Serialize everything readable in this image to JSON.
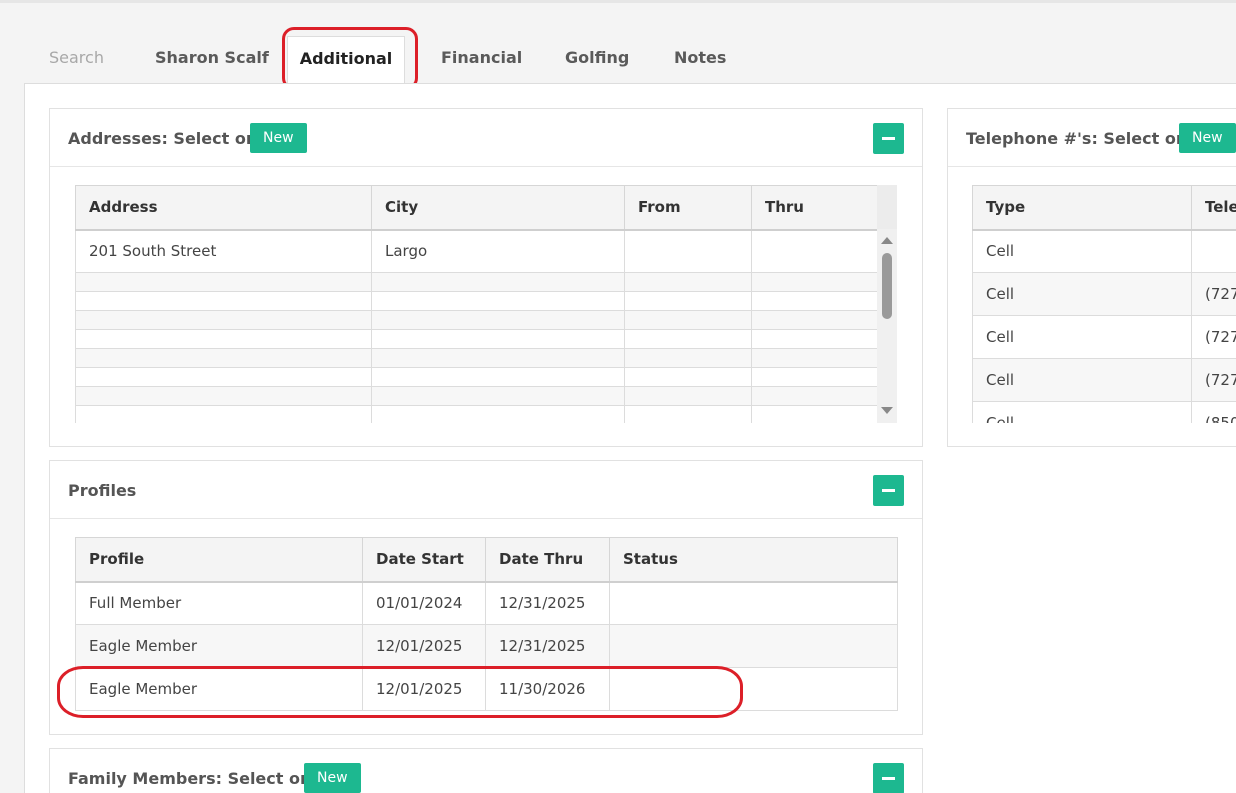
{
  "tabs": [
    "Search",
    "Sharon Scalf",
    "Additional",
    "Financial",
    "Golfing",
    "Notes"
  ],
  "addresses": {
    "title": "Addresses: Select or",
    "new_label": "New",
    "columns": [
      "Address",
      "City",
      "From",
      "Thru"
    ],
    "rows": [
      {
        "address": "201 South Street",
        "city": "Largo",
        "from": "",
        "thru": ""
      }
    ]
  },
  "phones": {
    "title": "Telephone #'s: Select or",
    "new_label": "New",
    "columns": [
      "Type",
      "Tele"
    ],
    "rows": [
      {
        "type": "Cell",
        "tele": ""
      },
      {
        "type": "Cell",
        "tele": "(727"
      },
      {
        "type": "Cell",
        "tele": "(727"
      },
      {
        "type": "Cell",
        "tele": "(727"
      },
      {
        "type": "Cell",
        "tele": "(850"
      }
    ]
  },
  "profiles": {
    "title": "Profiles",
    "columns": [
      "Profile",
      "Date Start",
      "Date Thru",
      "Status"
    ],
    "rows": [
      {
        "profile": "Full Member",
        "start": "01/01/2024",
        "thru": "12/31/2025",
        "status": ""
      },
      {
        "profile": "Eagle Member",
        "start": "12/01/2025",
        "thru": "12/31/2025",
        "status": ""
      },
      {
        "profile": "Eagle Member",
        "start": "12/01/2025",
        "thru": "11/30/2026",
        "status": ""
      }
    ]
  },
  "family": {
    "title": "Family Members: Select or",
    "new_label": "New"
  },
  "colors": {
    "accent": "#1db890",
    "annotation": "#dc1f28"
  }
}
